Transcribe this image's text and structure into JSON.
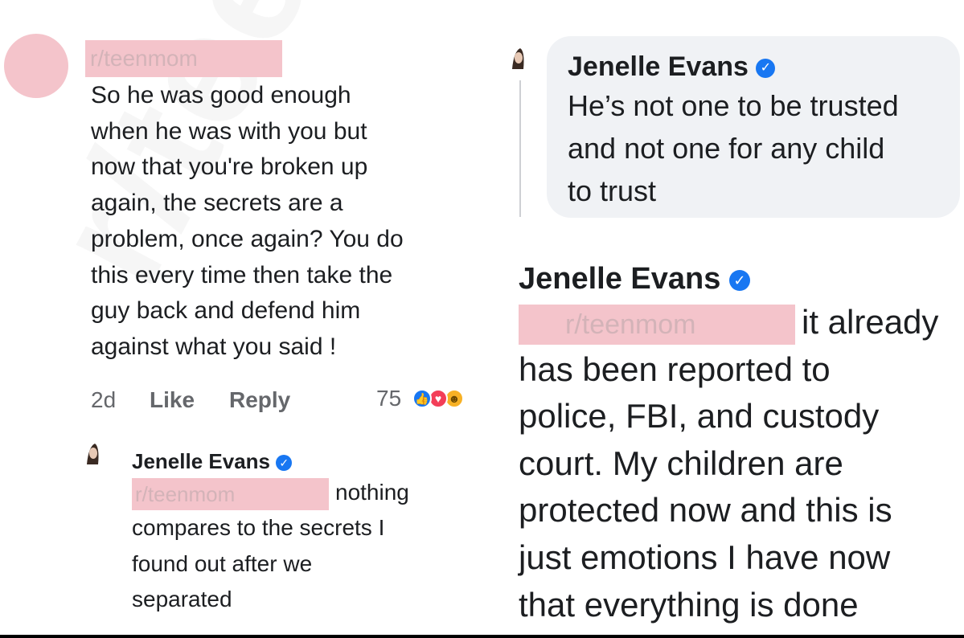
{
  "watermark": "r/teenmom",
  "left_comment": {
    "redacted_user": "r/teenmom",
    "lines": [
      "So he was good enough",
      "when he was with you but",
      "now that you're broken up",
      "again, the secrets are a",
      "problem, once again? You do",
      "this every time then take the",
      "guy back and defend him",
      "against what you said !"
    ],
    "time": "2d",
    "like_label": "Like",
    "reply_label": "Reply",
    "reaction_count": "75",
    "reactions": [
      "like-icon",
      "love-icon",
      "haha-icon"
    ]
  },
  "left_reply": {
    "author": "Jenelle Evans",
    "verified": true,
    "redacted_user": "r/teenmom",
    "first_line_rest": "nothing",
    "lines": [
      "compares to the secrets I",
      "found out after we",
      "separated"
    ]
  },
  "right_bubble": {
    "author": "Jenelle Evans",
    "verified": true,
    "lines": [
      "He’s not one to be trusted",
      "and not one for any child",
      "to trust"
    ]
  },
  "right_comment": {
    "author": "Jenelle Evans",
    "verified": true,
    "redacted_user": "r/teenmom",
    "first_line_rest": "it already",
    "lines": [
      "has been reported to",
      "police, FBI, and custody",
      "court. My children are",
      "protected now and this is",
      "just emotions I have now",
      "that everything is done"
    ]
  },
  "colors": {
    "redaction": "#f4c4cb",
    "verified_badge": "#1877f2",
    "bubble_bg": "#f0f2f5",
    "meta_text": "#65676b"
  }
}
